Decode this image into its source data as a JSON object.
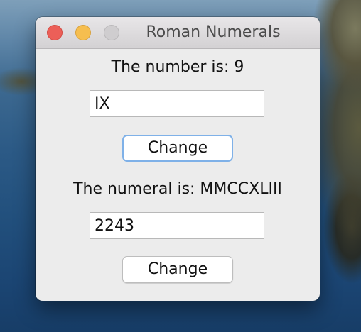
{
  "window": {
    "title": "Roman Numerals"
  },
  "number_section": {
    "label": "The number is: 9",
    "input_value": "IX",
    "button_label": "Change"
  },
  "numeral_section": {
    "label": "The numeral is: MMCCXLIII",
    "input_value": "2243",
    "button_label": "Change"
  },
  "colors": {
    "close": "#ec5f58",
    "minimize": "#f6be4f",
    "maximize_disabled": "#cfcdcf",
    "focus_ring": "#7fb1e8"
  }
}
